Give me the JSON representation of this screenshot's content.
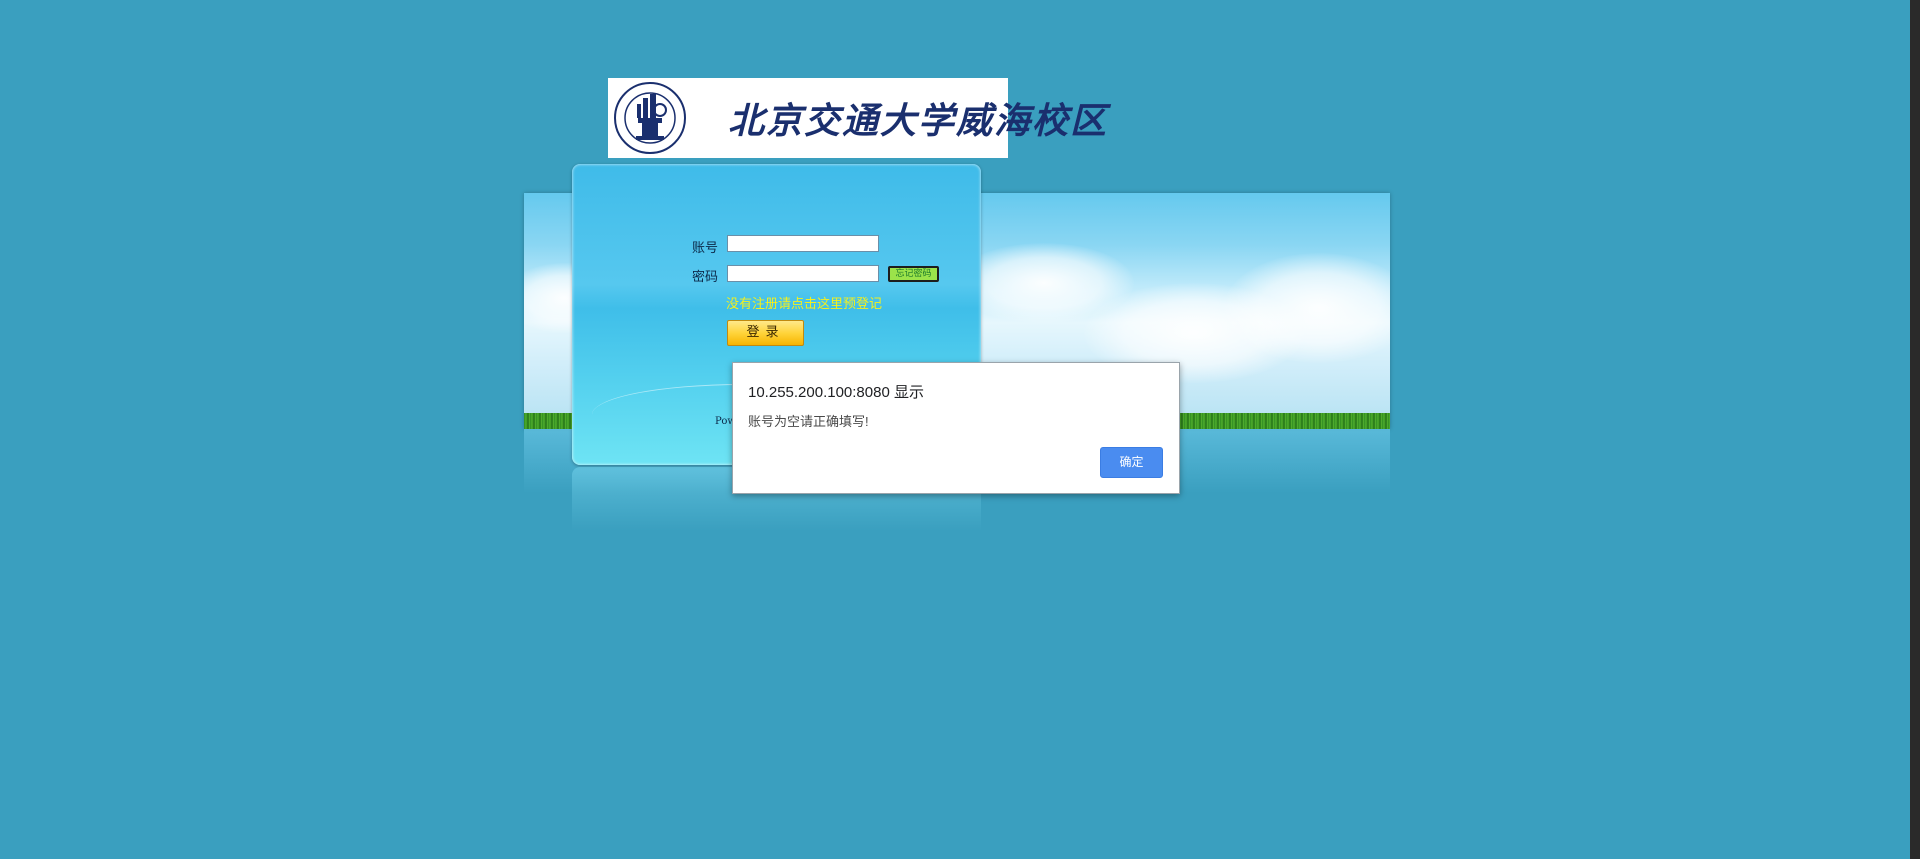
{
  "logo": {
    "university_name": "北京交通大学威海校区"
  },
  "login_form": {
    "account_label": "账号",
    "password_label": "密码",
    "account_value": "",
    "password_value": "",
    "forgot_password_button": "忘记密码",
    "register_link": "没有注册请点击这里预登记",
    "login_button": "登录",
    "powered_text": "Pow"
  },
  "alert": {
    "title": "10.255.200.100:8080 显示",
    "message": "账号为空请正确填写!",
    "ok_button": "确定"
  },
  "colors": {
    "background": "#3a9fbf",
    "register_link": "#f4f01c",
    "login_button": "#ffd43b",
    "alert_ok_button": "#4a8cf0"
  }
}
